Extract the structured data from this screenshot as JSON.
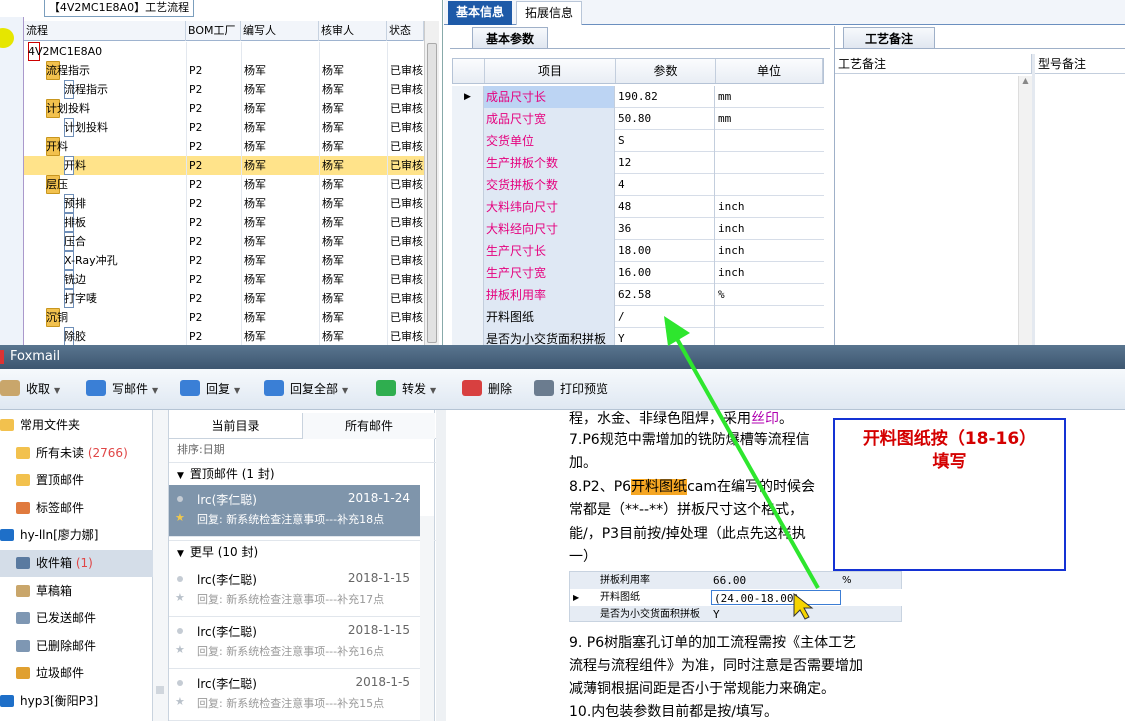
{
  "erp": {
    "window_title": "【4V2MC1E8A0】工艺流程",
    "tree_columns": [
      "流程",
      "BOM工厂",
      "编写人",
      "核审人",
      "状态"
    ],
    "tree_rows": [
      {
        "name": "4V2MC1E8A0",
        "indent": 0,
        "kind": "root",
        "bom": "",
        "writer": "",
        "reviewer": "",
        "status": ""
      },
      {
        "name": "流程指示",
        "indent": 1,
        "kind": "folder",
        "bom": "P2",
        "writer": "杨军",
        "reviewer": "杨军",
        "status": "已审核"
      },
      {
        "name": "流程指示",
        "indent": 2,
        "kind": "doc",
        "bom": "P2",
        "writer": "杨军",
        "reviewer": "杨军",
        "status": "已审核"
      },
      {
        "name": "计划投料",
        "indent": 1,
        "kind": "folder",
        "bom": "P2",
        "writer": "杨军",
        "reviewer": "杨军",
        "status": "已审核"
      },
      {
        "name": "计划投料",
        "indent": 2,
        "kind": "doc",
        "bom": "P2",
        "writer": "杨军",
        "reviewer": "杨军",
        "status": "已审核"
      },
      {
        "name": "开料",
        "indent": 1,
        "kind": "folder",
        "bom": "P2",
        "writer": "杨军",
        "reviewer": "杨军",
        "status": "已审核"
      },
      {
        "name": "开料",
        "indent": 2,
        "kind": "doc",
        "bom": "P2",
        "writer": "杨军",
        "reviewer": "杨军",
        "status": "已审核",
        "selected": true
      },
      {
        "name": "层压",
        "indent": 1,
        "kind": "folder",
        "bom": "P2",
        "writer": "杨军",
        "reviewer": "杨军",
        "status": "已审核"
      },
      {
        "name": "预排",
        "indent": 2,
        "kind": "doc",
        "bom": "P2",
        "writer": "杨军",
        "reviewer": "杨军",
        "status": "已审核"
      },
      {
        "name": "排板",
        "indent": 2,
        "kind": "doc",
        "bom": "P2",
        "writer": "杨军",
        "reviewer": "杨军",
        "status": "已审核"
      },
      {
        "name": "压合",
        "indent": 2,
        "kind": "doc",
        "bom": "P2",
        "writer": "杨军",
        "reviewer": "杨军",
        "status": "已审核"
      },
      {
        "name": "X-Ray冲孔",
        "indent": 2,
        "kind": "doc",
        "bom": "P2",
        "writer": "杨军",
        "reviewer": "杨军",
        "status": "已审核"
      },
      {
        "name": "铣边",
        "indent": 2,
        "kind": "doc",
        "bom": "P2",
        "writer": "杨军",
        "reviewer": "杨军",
        "status": "已审核"
      },
      {
        "name": "打字唛",
        "indent": 2,
        "kind": "doc",
        "bom": "P2",
        "writer": "杨军",
        "reviewer": "杨军",
        "status": "已审核"
      },
      {
        "name": "沉铜",
        "indent": 1,
        "kind": "folder",
        "bom": "P2",
        "writer": "杨军",
        "reviewer": "杨军",
        "status": "已审核"
      },
      {
        "name": "除胶",
        "indent": 2,
        "kind": "doc",
        "bom": "P2",
        "writer": "杨军",
        "reviewer": "杨军",
        "status": "已审核"
      }
    ],
    "tabs": [
      "基本信息",
      "拓展信息"
    ],
    "param_tab": "基本参数",
    "param_columns": [
      "项目",
      "参数",
      "单位"
    ],
    "params": [
      {
        "name": "成品尺寸长",
        "value": "190.82",
        "unit": "mm",
        "hl": true,
        "current": true
      },
      {
        "name": "成品尺寸宽",
        "value": "50.80",
        "unit": "mm"
      },
      {
        "name": "交货单位",
        "value": "S",
        "unit": ""
      },
      {
        "name": "生产拼板个数",
        "value": "12",
        "unit": ""
      },
      {
        "name": "交货拼板个数",
        "value": "4",
        "unit": ""
      },
      {
        "name": "大料纬向尺寸",
        "value": "48",
        "unit": "inch"
      },
      {
        "name": "大料经向尺寸",
        "value": "36",
        "unit": "inch"
      },
      {
        "name": "生产尺寸长",
        "value": "18.00",
        "unit": "inch"
      },
      {
        "name": "生产尺寸宽",
        "value": "16.00",
        "unit": "inch"
      },
      {
        "name": "拼板利用率",
        "value": "62.58",
        "unit": "%"
      },
      {
        "name": "开料图纸",
        "value": "/",
        "unit": "",
        "black": true
      },
      {
        "name": "是否为小交货面积拼板",
        "value": "Y",
        "unit": "",
        "black": true
      }
    ],
    "notes_tab": "工艺备注",
    "notes_columns": [
      "工艺备注",
      "型号备注"
    ]
  },
  "foxmail": {
    "title": "Foxmail",
    "toolbar": [
      {
        "label": "收取",
        "dd": true
      },
      {
        "label": "写邮件",
        "dd": true
      },
      {
        "label": "回复",
        "dd": true
      },
      {
        "label": "回复全部",
        "dd": true
      },
      {
        "label": "转发",
        "dd": true
      },
      {
        "label": "删除",
        "dd": false
      },
      {
        "label": "打印预览",
        "dd": false
      }
    ],
    "sidebar": [
      {
        "label": "常用文件夹",
        "count": "",
        "acc": true
      },
      {
        "label": "所有未读",
        "count": "(2766)"
      },
      {
        "label": "置顶邮件",
        "count": ""
      },
      {
        "label": "标签邮件",
        "count": ""
      },
      {
        "label": "hy-lln[廖力娜]",
        "count": "",
        "acc": true
      },
      {
        "label": "收件箱",
        "count": "(1)",
        "selected": true
      },
      {
        "label": "草稿箱",
        "count": ""
      },
      {
        "label": "已发送邮件",
        "count": ""
      },
      {
        "label": "已删除邮件",
        "count": ""
      },
      {
        "label": "垃圾邮件",
        "count": ""
      },
      {
        "label": "hyp3[衡阳P3]",
        "count": "",
        "acc": true
      }
    ],
    "list_tabs": [
      "当前目录",
      "所有邮件"
    ],
    "sort_label": "排序:日期",
    "groups": [
      {
        "label": "置顶邮件 (1 封)"
      },
      {
        "label": "更早 (10 封)"
      }
    ],
    "mails": [
      {
        "from": "lrc(李仁聪)",
        "date": "2018-1-24",
        "subject": "回复: 新系统检查注意事项---补充18点",
        "selected": true
      },
      {
        "from": "lrc(李仁聪)",
        "date": "2018-1-15",
        "subject": "回复: 新系统检查注意事项---补充17点"
      },
      {
        "from": "lrc(李仁聪)",
        "date": "2018-1-15",
        "subject": "回复: 新系统检查注意事项---补充16点"
      },
      {
        "from": "lrc(李仁聪)",
        "date": "2018-1-5",
        "subject": "回复: 新系统检查注意事项---补充15点"
      }
    ],
    "body": {
      "line0a": "程，水金、非绿色阻焊，采用",
      "line0b": "丝印",
      "line0c": "。",
      "line1": "7.P6规范中需增加的铣防爆槽等流程信",
      "line2": "加。",
      "line3a": "8.P2、P6",
      "line3b": "开料图纸",
      "line3c": "cam在编写的时候会",
      "line4": "常都是（**--**）拼板尺寸这个格式，",
      "line5": "能/，P3目前按/掉处理（此点先这样执",
      "line6": "一）",
      "line7": "9. P6树脂塞孔订单的加工流程需按《主体工艺",
      "line8": "流程与流程组件》为准，同时注意是否需要增加",
      "line9": "减薄铜根据间距是否小于常规能力来确定。",
      "line10": "10.内包装参数目前都是按/填写。"
    },
    "mini": {
      "r1_name": "拼板利用率",
      "r1_val": "66.00",
      "r1_unit": "%",
      "r2_name": "开料图纸",
      "r2_val": "(24.00-18.00)",
      "r3_name": "是否为小交货面积拼板",
      "r3_val": "Y"
    }
  },
  "callout": {
    "line1": "开料图纸按（18-16）",
    "line2": "填写"
  },
  "colors": {
    "accent": "#1e5aa8",
    "highlight_row": "#ffe38a",
    "pink_label": "#e5007e",
    "arrow": "#2ee62e",
    "callout_border": "#1432d4",
    "callout_text": "#d40000"
  }
}
